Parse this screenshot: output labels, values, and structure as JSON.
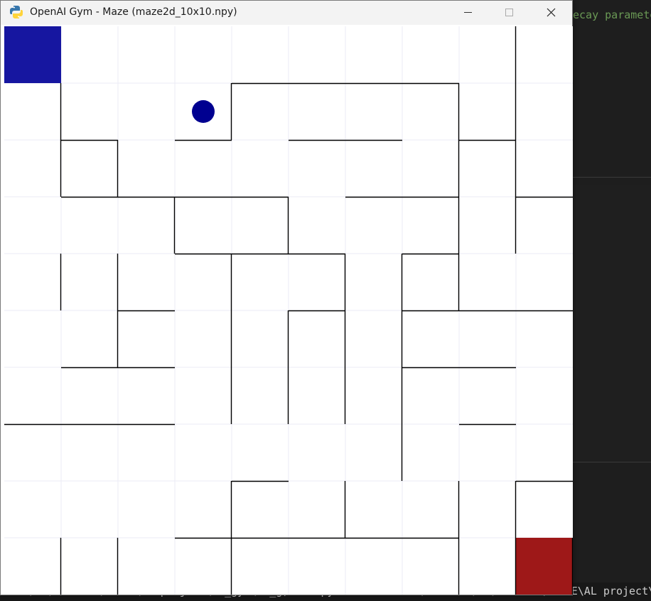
{
  "window": {
    "title": "OpenAI Gym - Maze (maze2d_10x10.npy)",
    "app_icon": "python-icon",
    "controls": [
      "minimize-icon",
      "maximize-icon",
      "close-icon"
    ]
  },
  "maze": {
    "rows": 10,
    "cols": 10,
    "entrance_cell": [
      0,
      0
    ],
    "goal_cell": [
      9,
      9
    ],
    "robot_cell": [
      3,
      1
    ],
    "colors": {
      "entrance": "#1616a0",
      "goal": "#9e1818",
      "robot": "#000090",
      "wall": "#000000",
      "grid": "#ebebf5",
      "floor": "#ffffff"
    },
    "horizontal_walls": [
      [
        1,
        4
      ],
      [
        1,
        5
      ],
      [
        1,
        6
      ],
      [
        1,
        7
      ],
      [
        2,
        1
      ],
      [
        2,
        3
      ],
      [
        2,
        5
      ],
      [
        2,
        6
      ],
      [
        2,
        8
      ],
      [
        3,
        1
      ],
      [
        3,
        2
      ],
      [
        3,
        3
      ],
      [
        3,
        4
      ],
      [
        3,
        6
      ],
      [
        3,
        7
      ],
      [
        3,
        9
      ],
      [
        4,
        3
      ],
      [
        4,
        4
      ],
      [
        4,
        5
      ],
      [
        4,
        7
      ],
      [
        5,
        2
      ],
      [
        5,
        5
      ],
      [
        5,
        7
      ],
      [
        5,
        8
      ],
      [
        5,
        9
      ],
      [
        6,
        1
      ],
      [
        6,
        2
      ],
      [
        6,
        7
      ],
      [
        6,
        8
      ],
      [
        7,
        0
      ],
      [
        7,
        1
      ],
      [
        7,
        2
      ],
      [
        7,
        8
      ],
      [
        8,
        4
      ],
      [
        8,
        9
      ],
      [
        9,
        3
      ],
      [
        9,
        4
      ],
      [
        9,
        5
      ],
      [
        9,
        6
      ],
      [
        9,
        7
      ]
    ],
    "vertical_walls": [
      [
        1,
        0
      ],
      [
        2,
        0
      ],
      [
        4,
        0
      ],
      [
        9,
        0
      ],
      [
        2,
        1
      ],
      [
        3,
        2
      ],
      [
        4,
        1
      ],
      [
        5,
        1
      ],
      [
        9,
        1
      ],
      [
        1,
        3
      ],
      [
        4,
        3
      ],
      [
        5,
        3
      ],
      [
        6,
        3
      ],
      [
        8,
        3
      ],
      [
        9,
        3
      ],
      [
        3,
        4
      ],
      [
        5,
        4
      ],
      [
        6,
        4
      ],
      [
        4,
        5
      ],
      [
        5,
        5
      ],
      [
        6,
        5
      ],
      [
        8,
        5
      ],
      [
        4,
        6
      ],
      [
        5,
        6
      ],
      [
        6,
        6
      ],
      [
        7,
        6
      ],
      [
        1,
        7
      ],
      [
        2,
        7
      ],
      [
        3,
        7
      ],
      [
        4,
        7
      ],
      [
        8,
        7
      ],
      [
        9,
        7
      ],
      [
        0,
        8
      ],
      [
        1,
        8
      ],
      [
        2,
        8
      ],
      [
        3,
        8
      ],
      [
        8,
        8
      ],
      [
        9,
        8
      ],
      [
        9,
        9
      ]
    ]
  },
  "background": {
    "editor_comment_fragment": "ecay paramete",
    "terminal_line": "wzlu\\r:\\SLD VLA\\SCORE\\AL project\\ai_gym\\ai_g)...  python    c  d:\\dravind\\r:\\SLD VLA\\SCORE\\AL project\\ai_g"
  }
}
